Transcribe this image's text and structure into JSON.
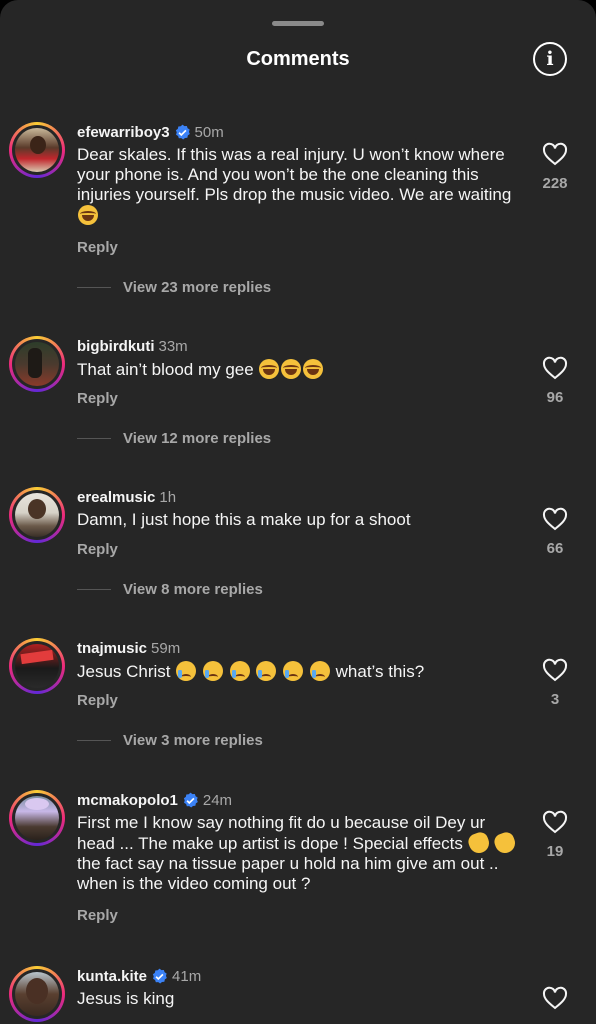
{
  "sheet": {
    "title": "Comments"
  },
  "icons": {
    "info": "info-icon",
    "verified": "verified-badge-icon",
    "like": "heart-outline-icon"
  },
  "colors": {
    "background": "#262626",
    "text": "#f5f5f5",
    "secondary": "#a8a8a8",
    "verified": "#3b82f6"
  },
  "comments": [
    {
      "username": "efewarriboy3",
      "verified": true,
      "time": "50m",
      "text_parts": [
        "Dear skales. If this was a real injury. U won’t know where your phone is.  And you won’t be the one cleaning this injuries yourself.  Pls drop the music video. We are waiting "
      ],
      "reply_label": "Reply",
      "view_replies": "View 23 more replies",
      "likes": "228"
    },
    {
      "username": "bigbirdkuti",
      "verified": false,
      "time": "33m",
      "text_parts": [
        "That ain’t blood my gee "
      ],
      "reply_label": "Reply",
      "view_replies": "View 12 more replies",
      "likes": "96"
    },
    {
      "username": "erealmusic",
      "verified": false,
      "time": "1h",
      "text_parts": [
        "Damn, I just hope this a make up for a shoot"
      ],
      "reply_label": "Reply",
      "view_replies": "View 8 more replies",
      "likes": "66"
    },
    {
      "username": "tnajmusic",
      "verified": false,
      "time": "59m",
      "text_parts": [
        "Jesus Christ ",
        " what’s this?"
      ],
      "reply_label": "Reply",
      "view_replies": "View 3 more replies",
      "likes": "3"
    },
    {
      "username": "mcmakopolo1",
      "verified": true,
      "time": "24m",
      "text_parts": [
        "First me I know say nothing fit do u because oil Dey ur head ... The make up artist is dope ! Special effects ",
        " the fact say na tissue paper u hold na him give am out .. when is the video coming out ?"
      ],
      "reply_label": "Reply",
      "likes": "19"
    },
    {
      "username": "kunta.kite",
      "verified": true,
      "time": "41m",
      "text_parts": [
        "Jesus is king"
      ]
    }
  ]
}
